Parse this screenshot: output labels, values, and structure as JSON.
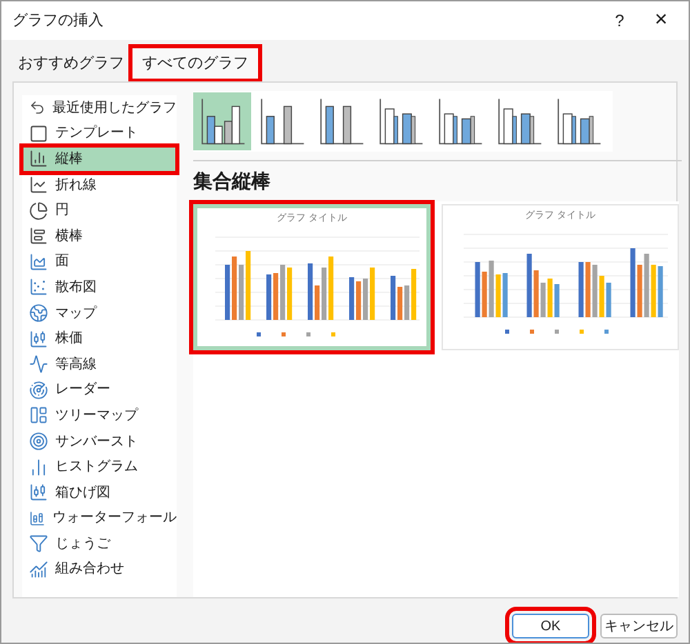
{
  "window": {
    "title": "グラフの挿入",
    "help": "?",
    "close": "×"
  },
  "tabs": [
    {
      "label": "おすすめグラフ",
      "selected": false,
      "highlighted": false
    },
    {
      "label": "すべてのグラフ",
      "selected": true,
      "highlighted": true
    }
  ],
  "sidebar": {
    "items": [
      {
        "label": "最近使用したグラフ",
        "selected": false,
        "highlighted": false
      },
      {
        "label": "テンプレート",
        "selected": false,
        "highlighted": false
      },
      {
        "label": "縦棒",
        "selected": true,
        "highlighted": true
      },
      {
        "label": "折れ線",
        "selected": false,
        "highlighted": false
      },
      {
        "label": "円",
        "selected": false,
        "highlighted": false
      },
      {
        "label": "横棒",
        "selected": false,
        "highlighted": false
      },
      {
        "label": "面",
        "selected": false,
        "highlighted": false
      },
      {
        "label": "散布図",
        "selected": false,
        "highlighted": false
      },
      {
        "label": "マップ",
        "selected": false,
        "highlighted": false
      },
      {
        "label": "株価",
        "selected": false,
        "highlighted": false
      },
      {
        "label": "等高線",
        "selected": false,
        "highlighted": false
      },
      {
        "label": "レーダー",
        "selected": false,
        "highlighted": false
      },
      {
        "label": "ツリーマップ",
        "selected": false,
        "highlighted": false
      },
      {
        "label": "サンバースト",
        "selected": false,
        "highlighted": false
      },
      {
        "label": "ヒストグラム",
        "selected": false,
        "highlighted": false
      },
      {
        "label": "箱ひげ図",
        "selected": false,
        "highlighted": false
      },
      {
        "label": "ウォーターフォール",
        "selected": false,
        "highlighted": false
      },
      {
        "label": "じょうご",
        "selected": false,
        "highlighted": false
      },
      {
        "label": "組み合わせ",
        "selected": false,
        "highlighted": false
      }
    ]
  },
  "subtypes": [
    {
      "selected": true
    },
    {
      "selected": false
    },
    {
      "selected": false
    },
    {
      "selected": false
    },
    {
      "selected": false
    },
    {
      "selected": false
    },
    {
      "selected": false
    }
  ],
  "subtype_title": "集合縦棒",
  "previews": [
    {
      "title": "グラフ タイトル",
      "selected": true,
      "highlighted": true
    },
    {
      "title": "グラフ タイトル",
      "selected": false,
      "highlighted": false
    }
  ],
  "buttons": [
    {
      "label": "OK",
      "highlighted": true
    },
    {
      "label": "キャンセル",
      "highlighted": false
    }
  ]
}
